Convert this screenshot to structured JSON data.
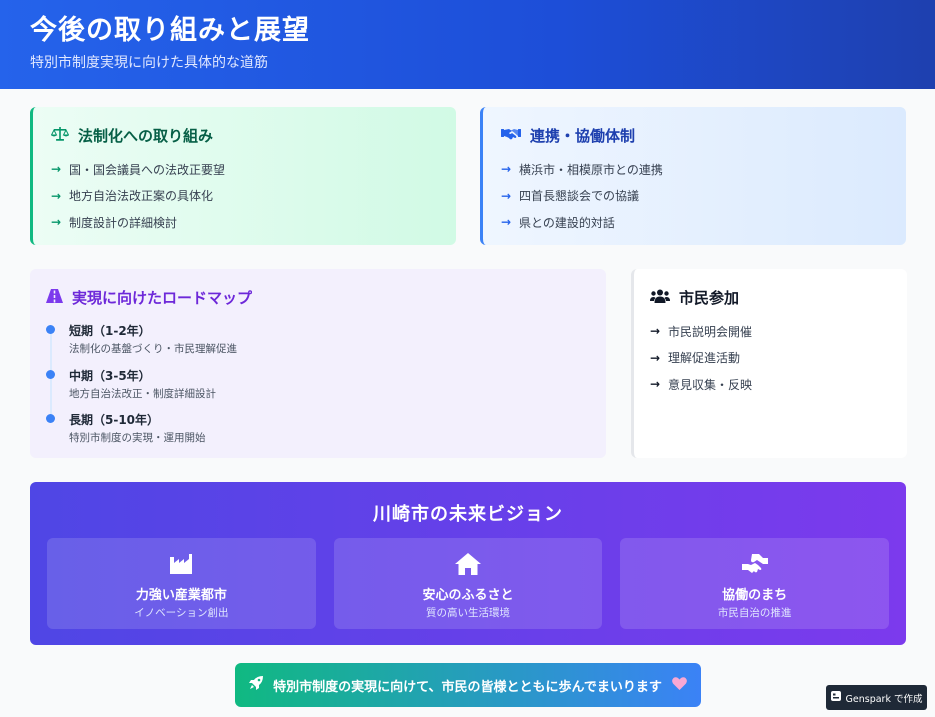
{
  "header": {
    "title": "今後の取り組みと展望",
    "subtitle": "特別市制度実現に向けた具体的な道筋"
  },
  "law": {
    "title": "法制化への取り組み",
    "icon": "scale-icon",
    "items": [
      "国・国会議員への法改正要望",
      "地方自治法改正案の具体化",
      "制度設計の詳細検討"
    ]
  },
  "coop": {
    "title": "連携・協働体制",
    "icon": "handshake-icon",
    "items": [
      "横浜市・相模原市との連携",
      "四首長懇談会での協議",
      "県との建設的対話"
    ]
  },
  "roadmap": {
    "title": "実現に向けたロードマップ",
    "icon": "road-icon",
    "phases": [
      {
        "title": "短期（1-2年）",
        "desc": "法制化の基盤づくり・市民理解促進"
      },
      {
        "title": "中期（3-5年）",
        "desc": "地方自治法改正・制度詳細設計"
      },
      {
        "title": "長期（5-10年）",
        "desc": "特別市制度の実現・運用開始"
      }
    ]
  },
  "citizen": {
    "title": "市民参加",
    "icon": "users-icon",
    "items": [
      "市民説明会開催",
      "理解促進活動",
      "意見収集・反映"
    ]
  },
  "vision": {
    "title": "川崎市の未来ビジョン",
    "items": [
      {
        "title": "力強い産業都市",
        "sub": "イノベーション創出",
        "icon": "industry-icon"
      },
      {
        "title": "安心のふるさと",
        "sub": "質の高い生活環境",
        "icon": "home-icon"
      },
      {
        "title": "協働のまち",
        "sub": "市民自治の推進",
        "icon": "hands-helping-icon"
      }
    ]
  },
  "banner": {
    "text": "特別市制度の実現に向けて、市民の皆様とともに歩んでまいります"
  },
  "badge": {
    "text": "Genspark で作成"
  },
  "colors": {
    "header": "#2563eb",
    "green": "#10b981",
    "blue": "#3b82f6",
    "purple": "#7c3aed"
  }
}
